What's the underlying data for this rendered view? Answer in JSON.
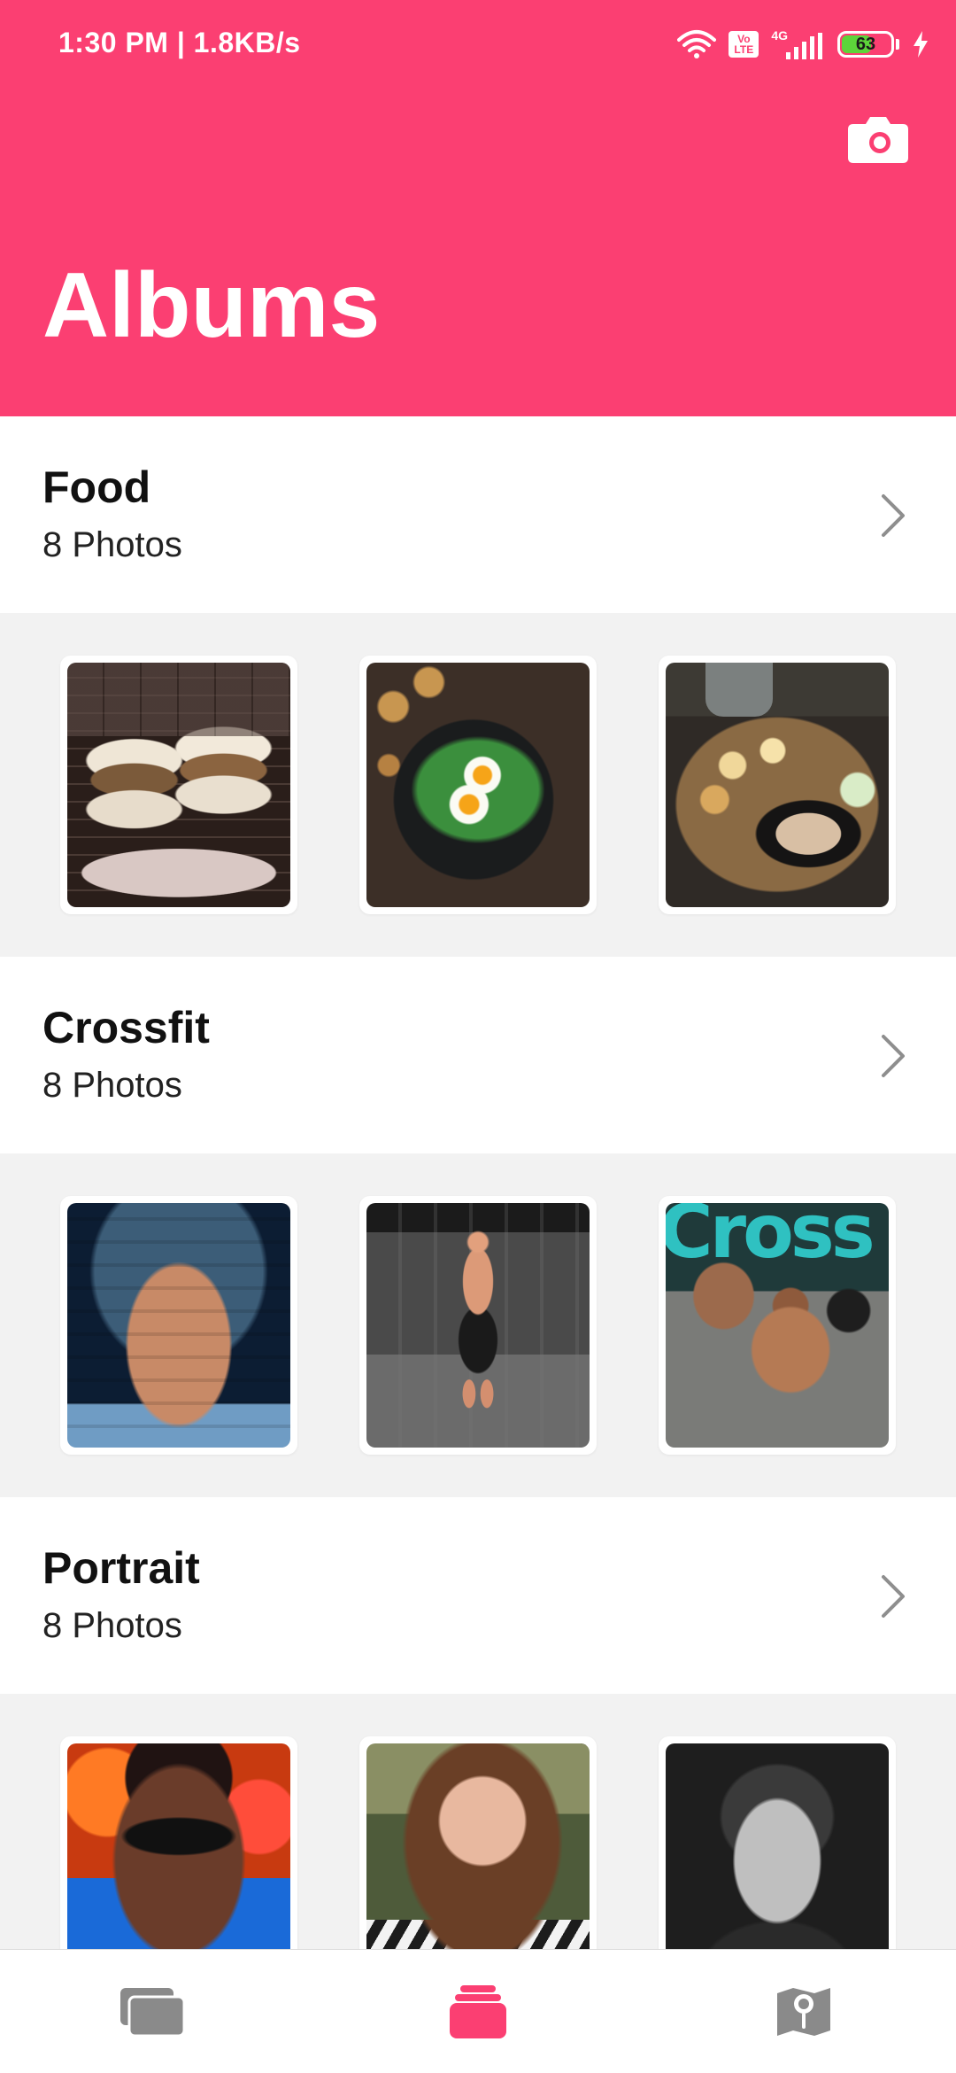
{
  "status_bar": {
    "time_and_speed": "1:30 PM | 1.8KB/s",
    "volte_top": "Vo",
    "volte_bottom": "LTE",
    "network_type": "4G",
    "battery_level": "63",
    "battery_fraction": 0.63,
    "battery_color": "#5dd43a"
  },
  "header": {
    "title": "Albums",
    "background_color": "#fb3f72",
    "camera_icon": "camera-icon"
  },
  "albums": [
    {
      "name": "Food",
      "count_label": "8 Photos",
      "photos": [
        "burger-photo",
        "eggs-photo",
        "salad-photo"
      ]
    },
    {
      "name": "Crossfit",
      "count_label": "8 Photos",
      "photos": [
        "abs-photo",
        "gym-photo",
        "crossfit-photo"
      ]
    },
    {
      "name": "Portrait",
      "count_label": "8 Photos",
      "photos": [
        "neon-portrait-photo",
        "woman-portrait-photo",
        "bw-portrait-photo"
      ]
    }
  ],
  "bottom_nav": {
    "items": [
      {
        "icon": "photos-stack-icon",
        "active": false
      },
      {
        "icon": "albums-icon",
        "active": true
      },
      {
        "icon": "map-pin-icon",
        "active": false
      }
    ],
    "active_color": "#fb3f72",
    "inactive_color": "#8a8a8a"
  }
}
